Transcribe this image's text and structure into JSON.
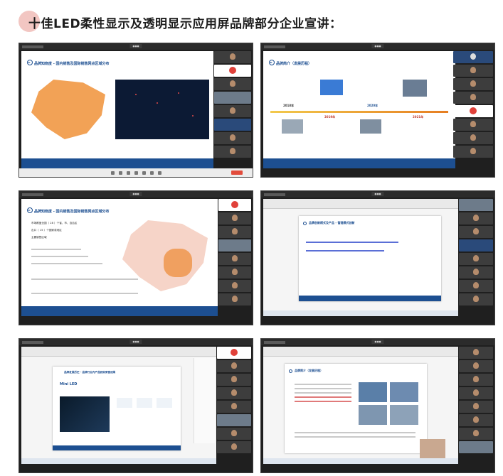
{
  "header": {
    "title": "十佳LED柔性显示及透明显示应用屏品牌部分企业宣讲："
  },
  "shots": [
    {
      "slide_title": "品牌知晓度 - 国内销售及国际销售网点区域分布"
    },
    {
      "slide_title": "品牌简介（发展历程）",
      "years": [
        "2018年",
        "2019年",
        "2020年",
        "2021年"
      ]
    },
    {
      "slide_title": "品牌知晓度 - 国内销售及国际销售网点区域分布",
      "bullets": [
        "市场覆盖全国（ 28 ）个省、市、自治区",
        "出口（ 15 ）个国家或地区",
        "主要销售区域"
      ]
    },
    {
      "slide_title": "品牌创新模式及产品 - 管理模式创新"
    },
    {
      "slide_title": "品牌发展历史 - 品牌行业内产品获奖荣誉成果",
      "product": "Mini LED"
    },
    {
      "slide_title": "品牌简介（发展历程）"
    }
  ],
  "colors": {
    "accent": "#1d4f91",
    "header_circle": "#f2c6c2",
    "end_button": "#e24c3c"
  }
}
